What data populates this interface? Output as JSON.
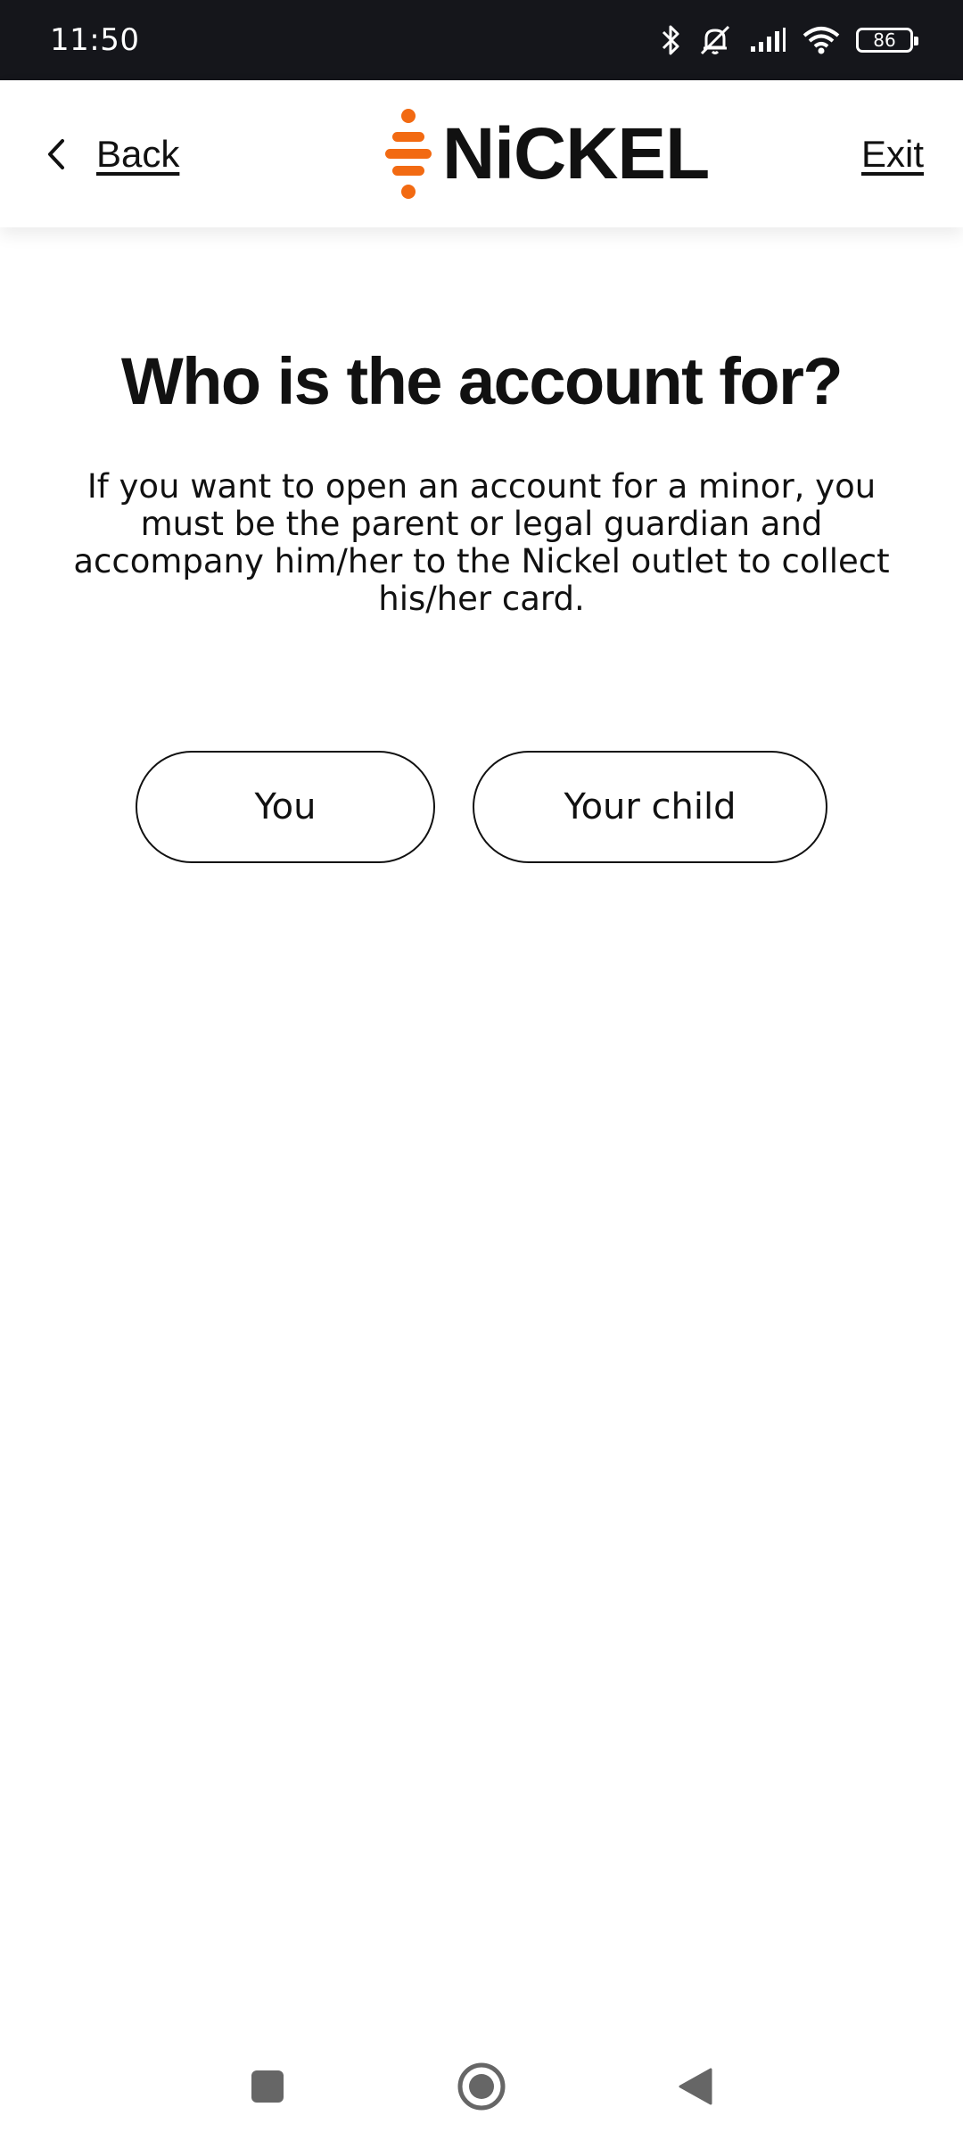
{
  "status_bar": {
    "time": "11:50",
    "battery": "86",
    "icons": [
      "bluetooth-icon",
      "muted-bell-icon",
      "signal-icon",
      "wifi-icon",
      "battery-icon"
    ]
  },
  "header": {
    "back_label": "Back",
    "exit_label": "Exit",
    "logo_text": "NiCKEL",
    "brand_color": "#f26a12"
  },
  "main": {
    "title": "Who is the account for?",
    "description": "If you want to open an account for a minor, you must be the parent or legal guardian and accompany him/her to the Nickel outlet to collect his/her card.",
    "options": [
      {
        "label": "You"
      },
      {
        "label": "Your child"
      }
    ]
  },
  "nav_bar": {
    "icons": [
      "recents-icon",
      "home-icon",
      "back-triangle-icon"
    ]
  }
}
